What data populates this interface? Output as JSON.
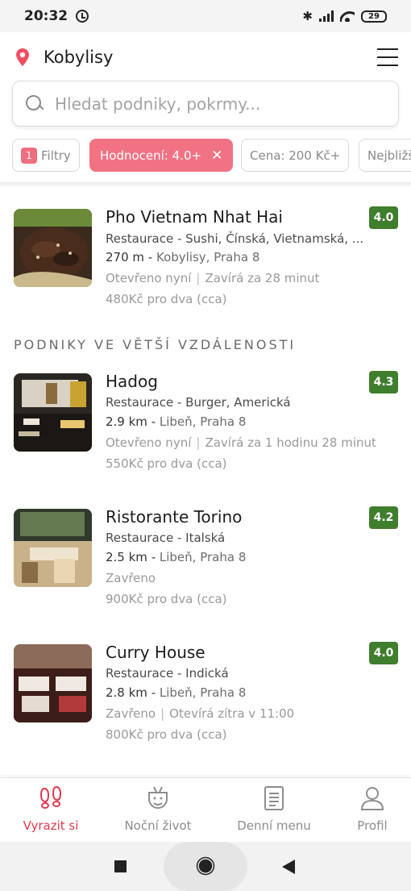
{
  "status_bar": {
    "time": "20:32",
    "battery": "29"
  },
  "header": {
    "location": "Kobylisy"
  },
  "search": {
    "placeholder": "Hledat podniky, pokrmy..."
  },
  "filters": {
    "filters_count": "1",
    "filters_label": "Filtry",
    "rating_label": "Hodnocení: 4.0+",
    "price_label": "Cena: 200 Kč+",
    "nearest_label": "Nejbližší"
  },
  "nearby": [
    {
      "name": "Pho Vietnam Nhat Hai",
      "rating": "4.0",
      "cuisine": "Restaurace - Sushi, Čínská, Vietnamská, ...",
      "distance": "270 m -",
      "area": "Kobylisy, Praha 8",
      "status": "Otevřeno nyní",
      "status_detail": "Zavírá za 28 minut",
      "price": "480Kč pro dva (cca)"
    }
  ],
  "section_title": "PODNIKY VE VĚTŠÍ VZDÁLENOSTI",
  "farther": [
    {
      "name": "Hadog",
      "rating": "4.3",
      "cuisine": "Restaurace - Burger, Americká",
      "distance": "2.9 km -",
      "area": "Libeň, Praha 8",
      "status": "Otevřeno nyní",
      "status_detail": "Zavírá za 1 hodinu 28 minut",
      "price": "550Kč pro dva (cca)"
    },
    {
      "name": "Ristorante Torino",
      "rating": "4.2",
      "cuisine": "Restaurace - Italská",
      "distance": "2.5 km -",
      "area": "Libeň, Praha 8",
      "status": "Zavřeno",
      "status_detail": "",
      "price": "900Kč pro dva (cca)"
    },
    {
      "name": "Curry House",
      "rating": "4.0",
      "cuisine": "Restaurace - Indická",
      "distance": "2.8 km -",
      "area": "Libeň, Praha 8",
      "status": "Zavřeno",
      "status_detail": "Otevírá zítra v 11:00",
      "price": "800Kč pro dva (cca)"
    }
  ],
  "bottom_nav": [
    {
      "label": "Vyrazit si",
      "icon": "footsteps-icon"
    },
    {
      "label": "Noční život",
      "icon": "nightlife-icon"
    },
    {
      "label": "Denní menu",
      "icon": "menu-document-icon"
    },
    {
      "label": "Profil",
      "icon": "profile-icon"
    }
  ],
  "colors": {
    "accent": "#f17283",
    "rating_green": "#3f7e2c",
    "active_nav": "#e2384d"
  }
}
